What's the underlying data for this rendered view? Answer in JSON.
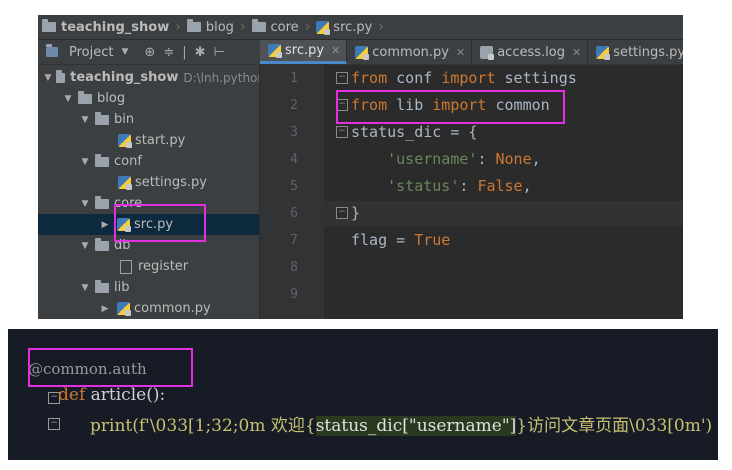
{
  "breadcrumbs": [
    "teaching_show",
    "blog",
    "core",
    "src.py"
  ],
  "project_panel": {
    "label": "Project"
  },
  "tabs": [
    {
      "label": "src.py",
      "active": true
    },
    {
      "label": "common.py"
    },
    {
      "label": "access.log"
    },
    {
      "label": "settings.py"
    }
  ],
  "tree": [
    {
      "label": "teaching_show",
      "path": "D:\\lnh.python"
    },
    {
      "label": "blog"
    },
    {
      "label": "bin"
    },
    {
      "label": "start.py"
    },
    {
      "label": "conf"
    },
    {
      "label": "settings.py"
    },
    {
      "label": "core"
    },
    {
      "label": "src.py"
    },
    {
      "label": "db"
    },
    {
      "label": "register"
    },
    {
      "label": "lib"
    },
    {
      "label": "common.py"
    }
  ],
  "editor": {
    "line_numbers": [
      "1",
      "2",
      "3",
      "4",
      "5",
      "6",
      "7",
      "8",
      "9"
    ],
    "lines": [
      {
        "parts": [
          [
            "kw",
            "from"
          ],
          [
            "t",
            " conf "
          ],
          [
            "kw",
            "import"
          ],
          [
            "t",
            " settings"
          ]
        ]
      },
      {
        "parts": [
          [
            "kw",
            "from"
          ],
          [
            "t",
            " lib "
          ],
          [
            "kw",
            "import"
          ],
          [
            "t",
            " common"
          ]
        ]
      },
      {
        "parts": [
          [
            "t",
            "status_dic = {"
          ]
        ]
      },
      {
        "parts": [
          [
            "t",
            "    "
          ],
          [
            "str",
            "'username'"
          ],
          [
            "t",
            ": "
          ],
          [
            "kw",
            "None"
          ],
          [
            "t",
            ","
          ]
        ]
      },
      {
        "parts": [
          [
            "t",
            "    "
          ],
          [
            "str",
            "'status'"
          ],
          [
            "t",
            ": "
          ],
          [
            "kw",
            "False"
          ],
          [
            "t",
            ","
          ]
        ]
      },
      {
        "parts": [
          [
            "t",
            "}"
          ]
        ]
      },
      {
        "parts": [
          [
            "t",
            "flag = "
          ],
          [
            "kw",
            "True"
          ]
        ]
      },
      {
        "parts": []
      },
      {
        "parts": []
      }
    ]
  },
  "bottom_code": {
    "decorator": "@common.auth",
    "def_kw": "def",
    "def_rest": " article():",
    "print_fn": "print",
    "print_open": "(f'\\033[1;32;0m 欢迎{",
    "print_expr": "status_dic[\"username\"]",
    "print_close": "}访问文章页面\\033[0m')"
  },
  "colors": {
    "highlight": "#e030e0",
    "keyword": "#cc7832",
    "string": "#6a8759"
  }
}
